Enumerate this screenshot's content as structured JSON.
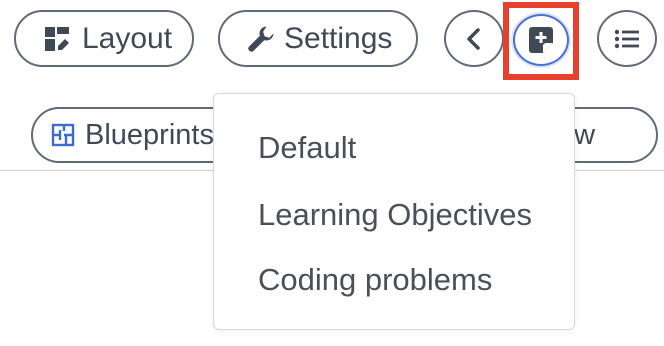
{
  "toolbar": {
    "layout_label": "Layout",
    "settings_label": "Settings"
  },
  "tabs": {
    "blueprints_label": "Blueprints",
    "review_label": "Review"
  },
  "dropdown": {
    "items": [
      {
        "label": "Default"
      },
      {
        "label": "Learning Objectives"
      },
      {
        "label": "Coding problems"
      }
    ]
  },
  "icons": {
    "layout": "layout-grid-icon",
    "settings": "wrench-icon",
    "back": "chevron-left-icon",
    "add_note": "add-note-icon",
    "list": "list-icon",
    "blueprints": "blueprint-icon"
  },
  "colors": {
    "border": "#5f6b78",
    "text": "#3f4a56",
    "menu_text": "#4a5059",
    "highlight": "#e8402c",
    "add_button_ring": "#4a6fd8",
    "blueprint_icon": "#3c6bd6"
  }
}
